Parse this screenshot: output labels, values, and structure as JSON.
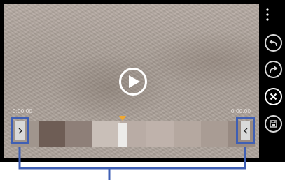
{
  "player": {
    "start_time": "0:00.00",
    "end_time": "0:00.00",
    "play_icon": "play-icon"
  },
  "trim": {
    "left_handle_icon": "chevron-right-icon",
    "right_handle_icon": "chevron-left-icon"
  },
  "toolbar": {
    "more_icon": "more-vertical-icon",
    "buttons": [
      "undo-icon",
      "redo-icon",
      "close-icon",
      "save-icon"
    ]
  },
  "colors": {
    "accent": "#3f5fb4",
    "playhead_marker": "#f0a830"
  }
}
